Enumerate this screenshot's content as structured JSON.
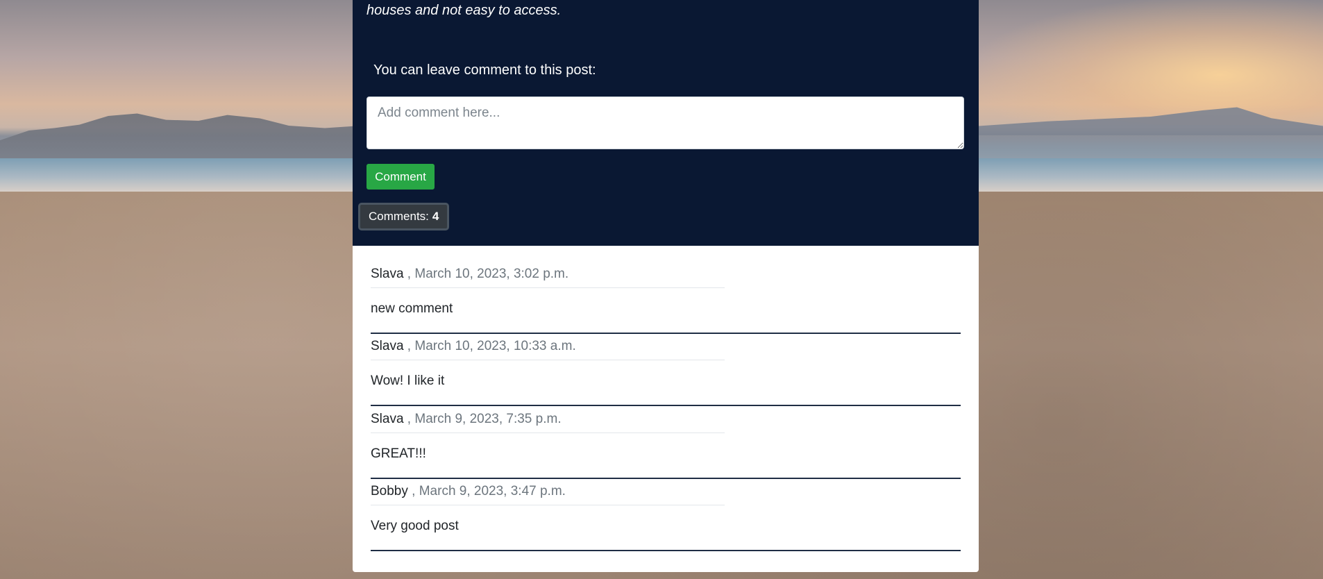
{
  "post": {
    "text_fragment": "houses and not easy to access."
  },
  "comment_form": {
    "prompt": "You can leave comment to this post:",
    "placeholder": "Add comment here...",
    "submit_label": "Comment"
  },
  "comments_summary": {
    "label": "Comments:",
    "count": "4"
  },
  "comments": [
    {
      "author": "Slava",
      "separator": " ,",
      "date": " March 10, 2023, 3:02 p.m.",
      "body": "new comment"
    },
    {
      "author": "Slava",
      "separator": " ,",
      "date": " March 10, 2023, 10:33 a.m.",
      "body": "Wow! I like it"
    },
    {
      "author": "Slava",
      "separator": " ,",
      "date": " March 9, 2023, 7:35 p.m.",
      "body": "GREAT!!!"
    },
    {
      "author": "Bobby",
      "separator": " ,",
      "date": " March 9, 2023, 3:47 p.m.",
      "body": "Very good post"
    }
  ],
  "colors": {
    "dark_panel": "#0a1833",
    "button_green": "#28a745",
    "badge_dark": "#343a40",
    "muted_text": "#6c757d"
  }
}
